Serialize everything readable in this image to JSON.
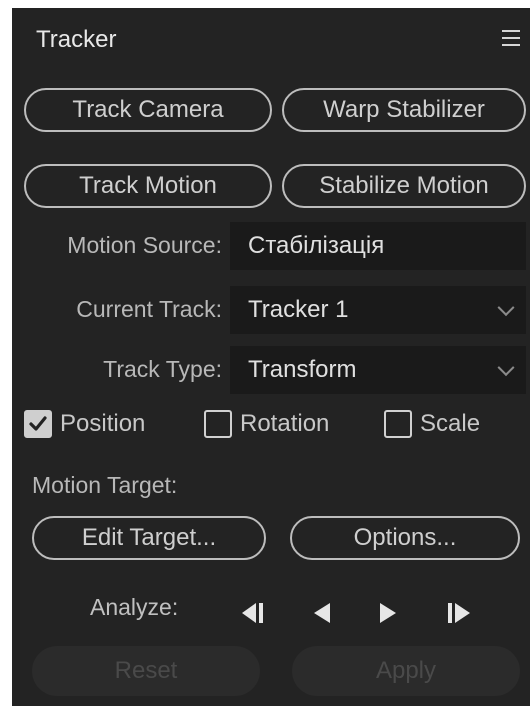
{
  "panel": {
    "title": "Tracker"
  },
  "buttons": {
    "track_camera": "Track Camera",
    "warp_stabilizer": "Warp Stabilizer",
    "track_motion": "Track Motion",
    "stabilize_motion": "Stabilize Motion",
    "edit_target": "Edit Target...",
    "options": "Options...",
    "reset": "Reset",
    "apply": "Apply"
  },
  "fields": {
    "motion_source_label": "Motion Source:",
    "motion_source_value": "Стабілізація",
    "current_track_label": "Current Track:",
    "current_track_value": "Tracker 1",
    "track_type_label": "Track Type:",
    "track_type_value": "Transform"
  },
  "checkboxes": {
    "position": {
      "label": "Position",
      "checked": true
    },
    "rotation": {
      "label": "Rotation",
      "checked": false
    },
    "scale": {
      "label": "Scale",
      "checked": false
    }
  },
  "motion_target_label": "Motion Target:",
  "analyze_label": "Analyze:",
  "icons": {
    "menu": "hamburger-menu-icon",
    "analyze_back_one": "step-backward-icon",
    "analyze_backward": "play-backward-icon",
    "analyze_forward": "play-forward-icon",
    "analyze_forward_one": "step-forward-icon"
  }
}
